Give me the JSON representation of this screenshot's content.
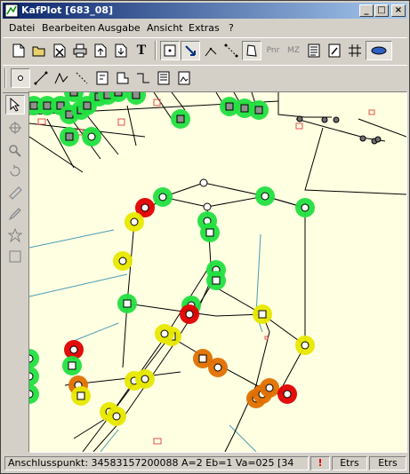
{
  "window": {
    "title": "KafPlot [683_08]",
    "minimize_glyph": "_",
    "maximize_glyph": "□",
    "close_glyph": "×"
  },
  "menu": [
    {
      "label": "Datei"
    },
    {
      "label": "Bearbeiten"
    },
    {
      "label": "Ausgabe"
    },
    {
      "label": "Ansicht"
    },
    {
      "label": "Extras"
    },
    {
      "label": "?"
    }
  ],
  "toolbar1": {
    "pnr_label": "Pnr",
    "mz_label": "MZ",
    "text_tool_label": "T"
  },
  "canvas": {
    "background": "#ffffe1",
    "point_colors": {
      "green": "#22e040",
      "yellow": "#e8e800",
      "orange": "#e07000",
      "red": "#e00000"
    },
    "line_color": "#000000",
    "water_color": "#4a9bb5",
    "parcel_color": "#e05050"
  },
  "statusbar": {
    "anschlusspunkt": "Anschlusspunkt: 34583157200088  A=2  Eb=1  Va=025  [34",
    "warning_glyph": "!",
    "etrs1": "Etrs",
    "etrs2": "Etrs"
  }
}
